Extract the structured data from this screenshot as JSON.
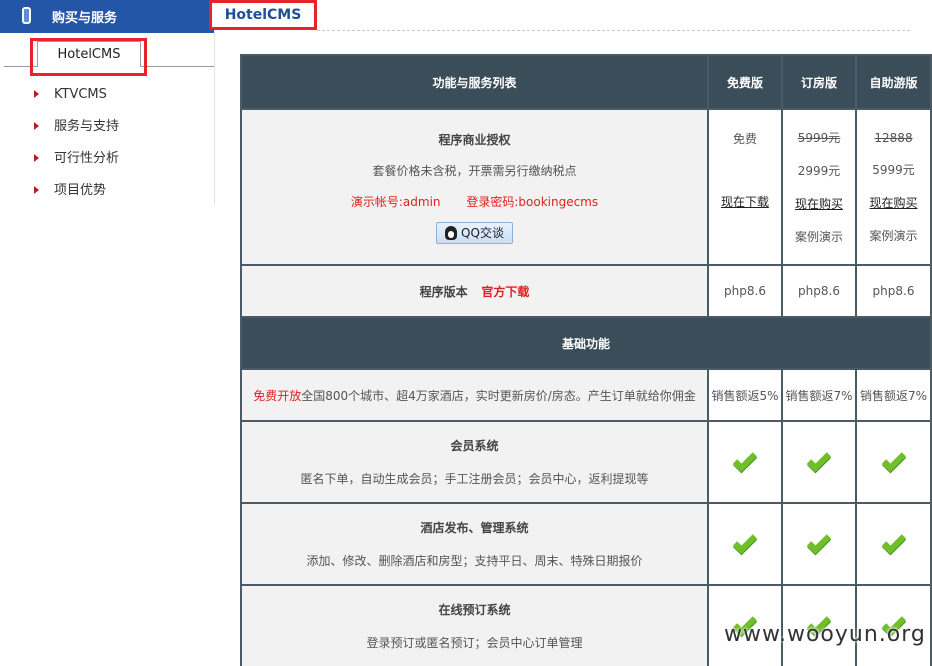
{
  "sidebar": {
    "header": "购买与服务",
    "active_tab": "HotelCMS",
    "items": [
      {
        "label": "KTVCMS"
      },
      {
        "label": "服务与支持"
      },
      {
        "label": "可行性分析"
      },
      {
        "label": "项目优势"
      }
    ]
  },
  "main": {
    "title": "HotelCMS"
  },
  "table": {
    "headers": [
      "功能与服务列表",
      "免费版",
      "订房版",
      "自助游版"
    ],
    "license": {
      "title": "程序商业授权",
      "note": "套餐价格未含税，开票需另行缴纳税点",
      "demo_account": "演示帐号:admin",
      "demo_password": "登录密码:bookingecms",
      "qq_button": "QQ交谈",
      "free": {
        "price": "免费",
        "action": "现在下载"
      },
      "booking": {
        "old_price": "5999元",
        "price": "2999元",
        "action": "现在购买",
        "demo": "案例演示"
      },
      "tour": {
        "old_price": "12888",
        "price": "5999元",
        "action": "现在购买",
        "demo": "案例演示"
      }
    },
    "version": {
      "label": "程序版本",
      "link": "官方下载",
      "values": [
        "php8.6",
        "php8.6",
        "php8.6"
      ]
    },
    "section_basic": "基础功能",
    "free_open": {
      "highlight": "免费开放",
      "text": "全国800个城市、超4万家酒店，实时更新房价/房态。产生订单就给你佣金",
      "values": [
        "销售额返5%",
        "销售额返7%",
        "销售额返7%"
      ]
    },
    "features": [
      {
        "title": "会员系统",
        "desc": "匿名下单，自动生成会员；手工注册会员；会员中心，返利提现等"
      },
      {
        "title": "酒店发布、管理系统",
        "desc": "添加、修改、删除酒店和房型；支持平日、周末、特殊日期报价"
      },
      {
        "title": "在线预订系统",
        "desc": "登录预订或匿名预订；会员中心订单管理"
      }
    ]
  },
  "watermark": "www.wooyun.org",
  "colors": {
    "header_bg": "#3a4d58",
    "sidebar_header": "#2456a8",
    "highlight_red": "#e8222a",
    "check_green": "#6fbf2a"
  }
}
